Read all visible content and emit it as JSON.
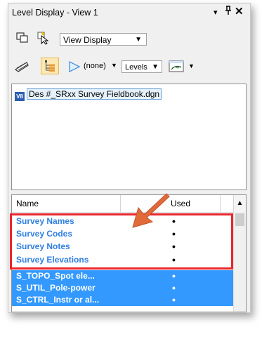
{
  "window": {
    "title": "Level Display - View 1",
    "controls": {
      "menu": "▾",
      "pin": "ᵠ",
      "close": "✕"
    }
  },
  "toolbar1": {
    "view_display": "View Display"
  },
  "toolbar2": {
    "filter_value": "(none)",
    "levels_label": "Levels"
  },
  "tree": {
    "icon_text": "V8",
    "file_label": "Des #_SRxx Survey Fieldbook.dgn"
  },
  "grid": {
    "columns": [
      "Name",
      "Used"
    ],
    "rows": [
      {
        "name": "Survey Names",
        "used": "•",
        "selected": false
      },
      {
        "name": "Survey Codes",
        "used": "•",
        "selected": false
      },
      {
        "name": "Survey Notes",
        "used": "•",
        "selected": false
      },
      {
        "name": "Survey Elevations",
        "used": "•",
        "selected": false
      },
      {
        "name": "S_TOPO_Spot ele...",
        "used": "•",
        "selected": true
      },
      {
        "name": "S_UTIL_Pole-power",
        "used": "•",
        "selected": true
      },
      {
        "name": "S_CTRL_Instr or al...",
        "used": "•",
        "selected": true
      }
    ]
  },
  "colors": {
    "highlight_box": "#e8262c",
    "annotation_arrow": "#e06a3a",
    "survey_text": "#2f7fe0",
    "selection": "#3399ff"
  }
}
